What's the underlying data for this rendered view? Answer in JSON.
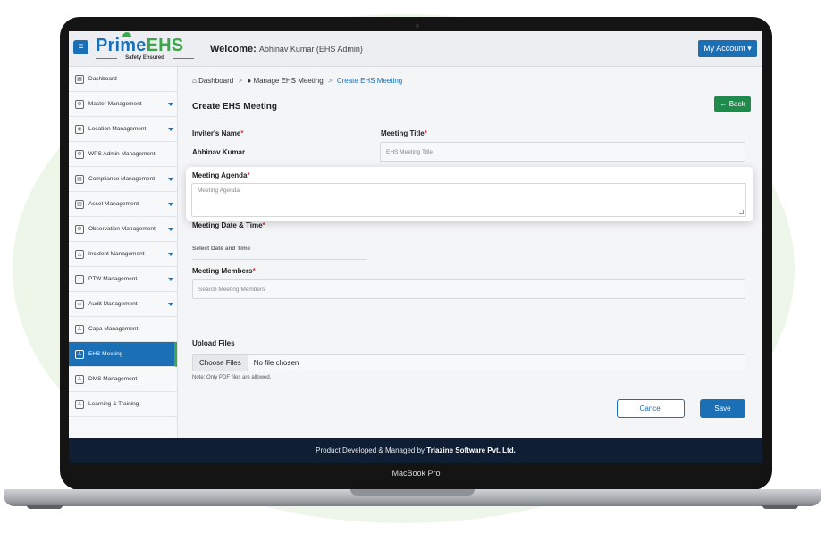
{
  "header": {
    "logo_prime": "Prime",
    "logo_ehs": "EHS",
    "logo_tagline": "Safety Ensured",
    "welcome_label": "Welcome:",
    "welcome_user": "Abhinav Kumar (EHS Admin)",
    "account_button": "My Account"
  },
  "sidebar": {
    "items": [
      {
        "label": "Dashboard",
        "icon": "dashboard-icon",
        "caret": false
      },
      {
        "label": "Master Management",
        "icon": "gear-icon",
        "caret": true
      },
      {
        "label": "Location Management",
        "icon": "location-pin-icon",
        "caret": true
      },
      {
        "label": "WPS Admin Management",
        "icon": "gear-icon",
        "caret": false
      },
      {
        "label": "Compliance Management",
        "icon": "document-icon",
        "caret": true
      },
      {
        "label": "Asset Management",
        "icon": "building-icon",
        "caret": true
      },
      {
        "label": "Observation Management",
        "icon": "gear-icon",
        "caret": true
      },
      {
        "label": "Incident Management",
        "icon": "warning-icon",
        "caret": true
      },
      {
        "label": "PTW Management",
        "icon": "gauge-icon",
        "caret": true
      },
      {
        "label": "Audit Management",
        "icon": "folder-icon",
        "caret": true
      },
      {
        "label": "Capa Management",
        "icon": "people-icon",
        "caret": false
      },
      {
        "label": "EHS Meeting",
        "icon": "people-icon",
        "caret": false,
        "active": true
      },
      {
        "label": "DMS Management",
        "icon": "people-icon",
        "caret": false
      },
      {
        "label": "Learning & Training",
        "icon": "trainer-icon",
        "caret": false
      }
    ]
  },
  "breadcrumb": {
    "home": "Dashboard",
    "parent": "Manage EHS Meeting",
    "current": "Create EHS Meeting"
  },
  "page": {
    "title": "Create EHS Meeting",
    "back_button": "Back"
  },
  "form": {
    "inviter_label": "Inviter's Name",
    "inviter_value": "Abhinav Kumar",
    "title_label": "Meeting Title",
    "title_placeholder": "EHS Meeting Title",
    "agenda_label": "Meeting Agenda",
    "agenda_placeholder": "Meeting Agenda",
    "datetime_label": "Meeting Date & Time",
    "datetime_placeholder": "Select Date and Time",
    "members_label": "Meeting Members",
    "members_placeholder": "Search Meeting Members",
    "upload_label": "Upload Files",
    "choose_files": "Choose Files",
    "no_file": "No file chosen",
    "upload_note": "Note: Only PDF files are allowed.",
    "cancel_button": "Cancel",
    "save_button": "Save"
  },
  "footer": {
    "prefix": "Product Developed & Managed by",
    "company": "Triazine Software Pvt. Ltd."
  },
  "device_label": "MacBook Pro",
  "colors": {
    "primary": "#1a6fb5",
    "accent": "#3aa84a",
    "back_button": "#1f8a4c",
    "footer": "#0f1e33"
  }
}
